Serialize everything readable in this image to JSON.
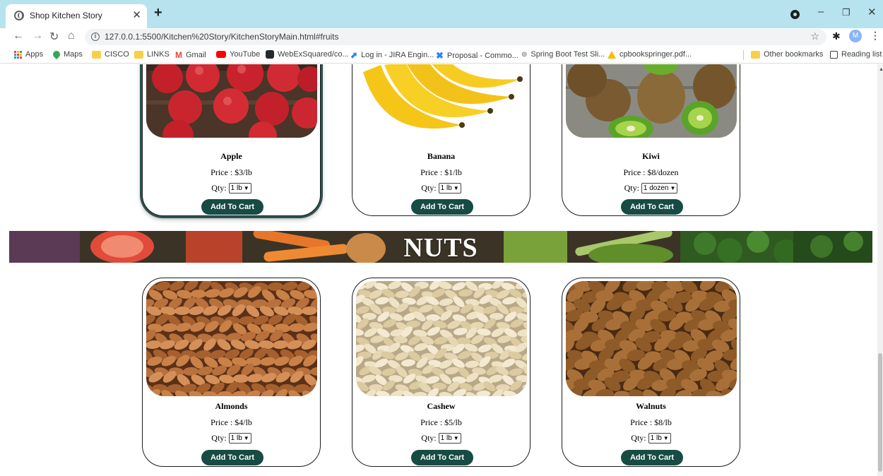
{
  "browser": {
    "tab_title": "Shop Kitchen Story",
    "url": "127.0.0.1:5500/Kitchen%20Story/KitchenStoryMain.html#fruits",
    "avatar_letter": "M"
  },
  "bookmarks": [
    {
      "label": "Apps",
      "icon": "apps-grid-icon"
    },
    {
      "label": "Maps",
      "icon": "maps-pin-icon"
    },
    {
      "label": "CISCO",
      "icon": "folder-icon"
    },
    {
      "label": "LINKS",
      "icon": "folder-icon"
    },
    {
      "label": "Gmail",
      "icon": "gmail-icon"
    },
    {
      "label": "YouTube",
      "icon": "youtube-icon"
    },
    {
      "label": "WebExSquared/co...",
      "icon": "github-icon"
    },
    {
      "label": "Log in - JIRA Engin...",
      "icon": "jira-icon"
    },
    {
      "label": "Proposal - Commo...",
      "icon": "confluence-icon"
    },
    {
      "label": "Spring Boot Test Sli...",
      "icon": "globe-icon"
    },
    {
      "label": "cpbookspringer.pdf...",
      "icon": "drive-icon"
    }
  ],
  "bookmarks_right": {
    "other": "Other bookmarks",
    "reading": "Reading list"
  },
  "fruits": [
    {
      "name": "Apple",
      "price": "Price : $3/lb",
      "qty_label": "Qty:",
      "qty_value": "1 lb",
      "button": "Add To Cart"
    },
    {
      "name": "Banana",
      "price": "Price : $1/lb",
      "qty_label": "Qty:",
      "qty_value": "1 lb",
      "button": "Add To Cart"
    },
    {
      "name": "Kiwi",
      "price": "Price : $8/dozen",
      "qty_label": "Qty:",
      "qty_value": "1 dozen",
      "button": "Add To Cart"
    }
  ],
  "nuts_section": {
    "title": "NUTS"
  },
  "nuts": [
    {
      "name": "Almonds",
      "price": "Price : $4/lb",
      "qty_label": "Qty:",
      "qty_value": "1 lb",
      "button": "Add To Cart"
    },
    {
      "name": "Cashew",
      "price": "Price : $5/lb",
      "qty_label": "Qty:",
      "qty_value": "1 lb",
      "button": "Add To Cart"
    },
    {
      "name": "Walnuts",
      "price": "Price : $8/lb",
      "qty_label": "Qty:",
      "qty_value": "1 lb",
      "button": "Add To Cart"
    }
  ],
  "colors": {
    "tabstrip": "#b7e3ef",
    "button": "#174b43"
  }
}
